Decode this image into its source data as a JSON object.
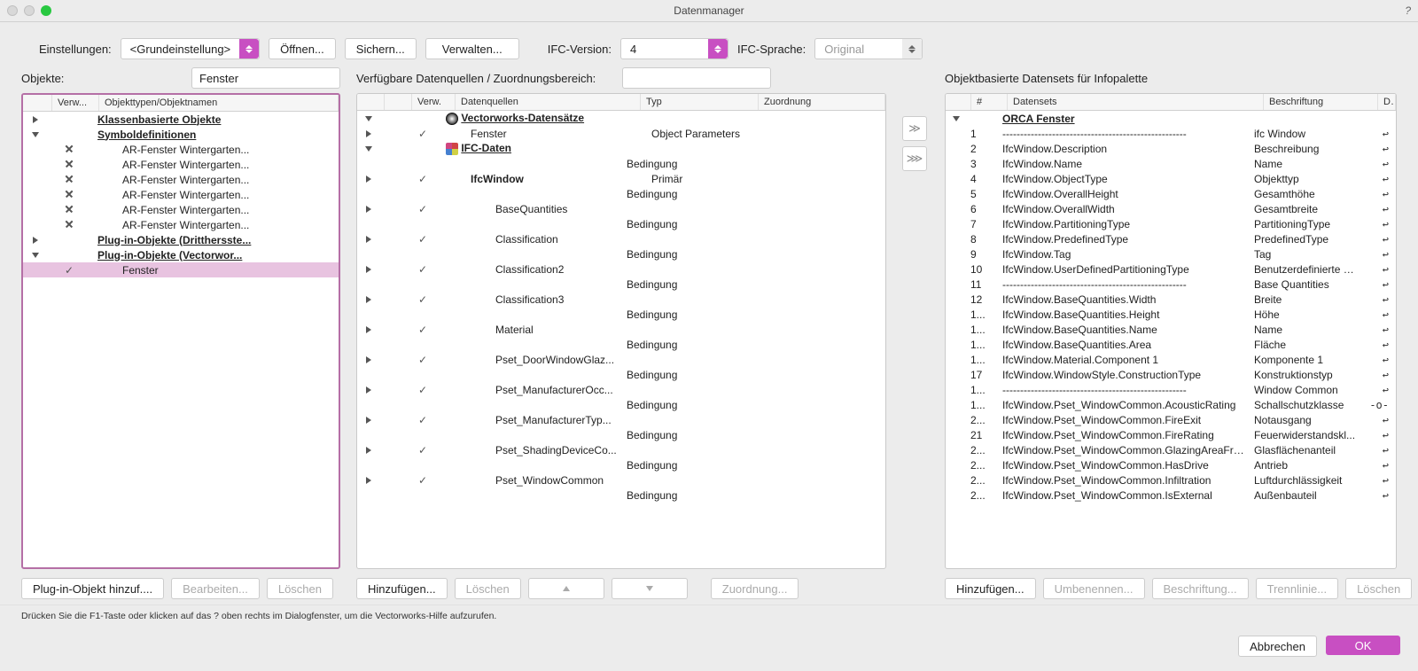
{
  "title": "Datenmanager",
  "settings": {
    "label": "Einstellungen:",
    "preset": "<Grundeinstellung>",
    "open": "Öffnen...",
    "save": "Sichern...",
    "manage": "Verwalten...",
    "ifc_version_label": "IFC-Version:",
    "ifc_version": "4",
    "ifc_lang_label": "IFC-Sprache:",
    "ifc_lang": "Original"
  },
  "objects": {
    "label": "Objekte:",
    "filter_value": "Fenster",
    "headers": {
      "verw": "Verw...",
      "types": "Objekttypen/Objektnamen"
    },
    "rows": [
      {
        "arrow": "right",
        "indent": 0,
        "label": "Klassenbasierte Objekte",
        "bu": true
      },
      {
        "arrow": "down",
        "indent": 0,
        "label": "Symboldefinitionen",
        "bu": true
      },
      {
        "indent": 2,
        "icon": "x",
        "label": "AR-Fenster Wintergarten..."
      },
      {
        "indent": 2,
        "icon": "x",
        "label": "AR-Fenster Wintergarten..."
      },
      {
        "indent": 2,
        "icon": "x",
        "label": "AR-Fenster Wintergarten..."
      },
      {
        "indent": 2,
        "icon": "x",
        "label": "AR-Fenster Wintergarten..."
      },
      {
        "indent": 2,
        "icon": "x",
        "label": "AR-Fenster Wintergarten..."
      },
      {
        "indent": 2,
        "icon": "x",
        "label": "AR-Fenster Wintergarten..."
      },
      {
        "arrow": "right",
        "indent": 0,
        "label": "Plug-in-Objekte (Dritthersste...",
        "bu": true
      },
      {
        "arrow": "down",
        "indent": 0,
        "label": "Plug-in-Objekte (Vectorwor...",
        "bu": true
      },
      {
        "indent": 2,
        "icon": "check",
        "label": "Fenster",
        "selected": true
      }
    ],
    "buttons": {
      "add": "Plug-in-Objekt hinzuf....",
      "edit": "Bearbeiten...",
      "del": "Löschen"
    }
  },
  "sources": {
    "label": "Verfügbare Datenquellen / Zuordnungsbereich:",
    "filter_value": "",
    "headers": {
      "verw": "Verw.",
      "src": "Datenquellen",
      "typ": "Typ",
      "assign": "Zuordnung"
    },
    "rows": [
      {
        "arrow": "down",
        "verw": "",
        "icon": "vw",
        "label": "Vectorworks-Datensätze",
        "bu": true,
        "typ": ""
      },
      {
        "arrow": "right",
        "verw": "check",
        "indent": 1,
        "label": "Fenster",
        "typ": "Object Parameters"
      },
      {
        "arrow": "down",
        "verw": "",
        "icon": "ifc",
        "label": "IFC-Daten",
        "bu": true,
        "typ": ""
      },
      {
        "typ": "Bedingung"
      },
      {
        "arrow": "right",
        "verw": "check",
        "indent": 1,
        "bold": true,
        "label": "IfcWindow",
        "typ": "Primär"
      },
      {
        "typ": "Bedingung"
      },
      {
        "arrow": "right",
        "verw": "check",
        "indent": 2,
        "label": "BaseQuantities",
        "typ": ""
      },
      {
        "typ": "Bedingung"
      },
      {
        "arrow": "right",
        "verw": "check",
        "indent": 2,
        "label": "Classification",
        "typ": ""
      },
      {
        "typ": "Bedingung"
      },
      {
        "arrow": "right",
        "verw": "check",
        "indent": 2,
        "label": "Classification2",
        "typ": ""
      },
      {
        "typ": "Bedingung"
      },
      {
        "arrow": "right",
        "verw": "check",
        "indent": 2,
        "label": "Classification3",
        "typ": ""
      },
      {
        "typ": "Bedingung"
      },
      {
        "arrow": "right",
        "verw": "check",
        "indent": 2,
        "label": "Material",
        "typ": ""
      },
      {
        "typ": "Bedingung"
      },
      {
        "arrow": "right",
        "verw": "check",
        "indent": 2,
        "label": "Pset_DoorWindowGlaz...",
        "typ": ""
      },
      {
        "typ": "Bedingung"
      },
      {
        "arrow": "right",
        "verw": "check",
        "indent": 2,
        "label": "Pset_ManufacturerOcc...",
        "typ": ""
      },
      {
        "typ": "Bedingung"
      },
      {
        "arrow": "right",
        "verw": "check",
        "indent": 2,
        "label": "Pset_ManufacturerTyp...",
        "typ": ""
      },
      {
        "typ": "Bedingung"
      },
      {
        "arrow": "right",
        "verw": "check",
        "indent": 2,
        "label": "Pset_ShadingDeviceCo...",
        "typ": ""
      },
      {
        "typ": "Bedingung"
      },
      {
        "arrow": "right",
        "verw": "check",
        "indent": 2,
        "label": "Pset_WindowCommon",
        "typ": ""
      },
      {
        "typ": "Bedingung"
      }
    ],
    "buttons": {
      "add": "Hinzufügen...",
      "del": "Löschen",
      "assign": "Zuordnung..."
    }
  },
  "datasets": {
    "label": "Objektbasierte Datensets für Infopalette",
    "headers": {
      "num": "#",
      "ds": "Datensets",
      "label": "Beschriftung",
      "dur": "Durch..."
    },
    "rows": [
      {
        "arrow": "down",
        "num": "",
        "ds": "ORCA Fenster",
        "bu": true,
        "label": "",
        "dur": ""
      },
      {
        "num": "1",
        "ds": "----------------------------------------------------",
        "label": "ifc Window",
        "dur": "reply"
      },
      {
        "num": "2",
        "ds": "IfcWindow.Description",
        "label": "Beschreibung",
        "dur": "reply"
      },
      {
        "num": "3",
        "ds": "IfcWindow.Name",
        "label": "Name",
        "dur": "reply"
      },
      {
        "num": "4",
        "ds": "IfcWindow.ObjectType",
        "label": "Objekttyp",
        "dur": "reply"
      },
      {
        "num": "5",
        "ds": "IfcWindow.OverallHeight",
        "label": "Gesamthöhe",
        "dur": "reply"
      },
      {
        "num": "6",
        "ds": "IfcWindow.OverallWidth",
        "label": "Gesamtbreite",
        "dur": "reply"
      },
      {
        "num": "7",
        "ds": "IfcWindow.PartitioningType",
        "label": "PartitioningType",
        "dur": "reply"
      },
      {
        "num": "8",
        "ds": "IfcWindow.PredefinedType",
        "label": "PredefinedType",
        "dur": "reply"
      },
      {
        "num": "9",
        "ds": "IfcWindow.Tag",
        "label": "Tag",
        "dur": "reply"
      },
      {
        "num": "10",
        "ds": "IfcWindow.UserDefinedPartitioningType",
        "label": "Benutzerdefinierte P...",
        "dur": "reply"
      },
      {
        "num": "11",
        "ds": "----------------------------------------------------",
        "label": "Base Quantities",
        "dur": "reply"
      },
      {
        "num": "12",
        "ds": "IfcWindow.BaseQuantities.Width",
        "label": "Breite",
        "dur": "reply"
      },
      {
        "num": "1...",
        "ds": "IfcWindow.BaseQuantities.Height",
        "label": "Höhe",
        "dur": "reply"
      },
      {
        "num": "1...",
        "ds": "IfcWindow.BaseQuantities.Name",
        "label": "Name",
        "dur": "reply"
      },
      {
        "num": "1...",
        "ds": "IfcWindow.BaseQuantities.Area",
        "label": "Fläche",
        "dur": "reply"
      },
      {
        "num": "1...",
        "ds": "IfcWindow.Material.Component 1",
        "label": "Komponente 1",
        "dur": "reply"
      },
      {
        "num": "17",
        "ds": "IfcWindow.WindowStyle.ConstructionType",
        "label": "Konstruktionstyp",
        "dur": "reply"
      },
      {
        "num": "1...",
        "ds": "----------------------------------------------------",
        "label": "Window Common",
        "dur": "reply"
      },
      {
        "num": "1...",
        "ds": "IfcWindow.Pset_WindowCommon.AcousticRating",
        "label": "Schallschutzklasse",
        "dur": "sep"
      },
      {
        "num": "2...",
        "ds": "IfcWindow.Pset_WindowCommon.FireExit",
        "label": "Notausgang",
        "dur": "reply"
      },
      {
        "num": "21",
        "ds": "IfcWindow.Pset_WindowCommon.FireRating",
        "label": "Feuerwiderstandskl...",
        "dur": "reply"
      },
      {
        "num": "2...",
        "ds": "IfcWindow.Pset_WindowCommon.GlazingAreaFra...",
        "label": "Glasflächenanteil",
        "dur": "reply"
      },
      {
        "num": "2...",
        "ds": "IfcWindow.Pset_WindowCommon.HasDrive",
        "label": "Antrieb",
        "dur": "reply"
      },
      {
        "num": "2...",
        "ds": "IfcWindow.Pset_WindowCommon.Infiltration",
        "label": "Luftdurchlässigkeit",
        "dur": "reply"
      },
      {
        "num": "2...",
        "ds": "IfcWindow.Pset_WindowCommon.IsExternal",
        "label": "Außenbauteil",
        "dur": "reply"
      }
    ],
    "buttons": {
      "add": "Hinzufügen...",
      "rename": "Umbenennen...",
      "label_btn": "Beschriftung...",
      "sep": "Trennlinie...",
      "del": "Löschen"
    }
  },
  "hint": "Drücken Sie die F1-Taste oder klicken auf das ? oben rechts im Dialogfenster, um die Vectorworks-Hilfe aufzurufen.",
  "footer": {
    "cancel": "Abbrechen",
    "ok": "OK"
  }
}
